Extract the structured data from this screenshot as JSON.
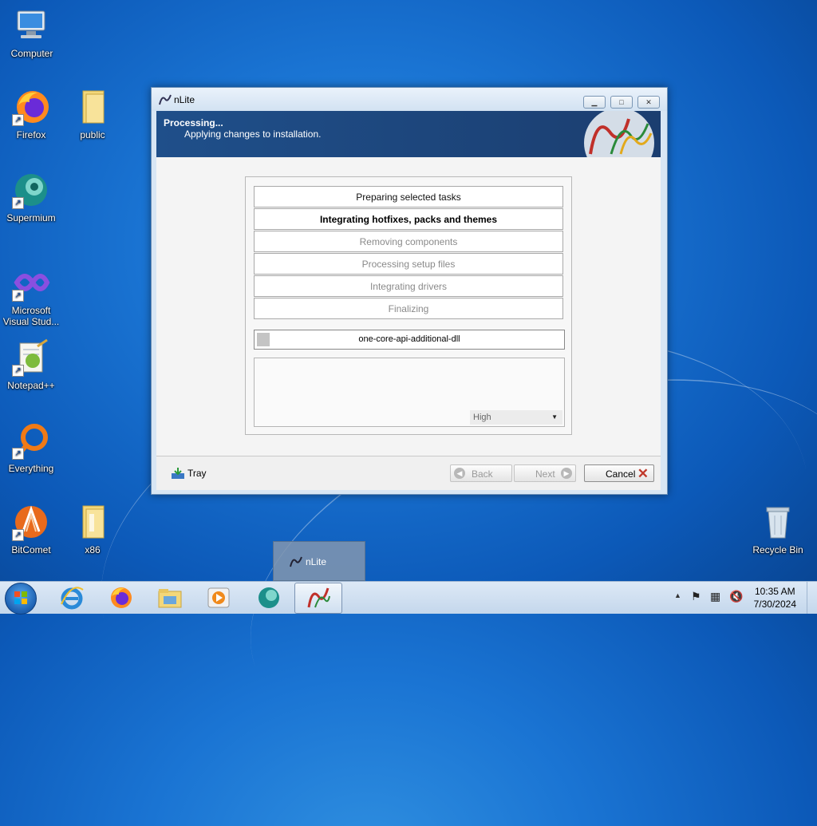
{
  "desktop": {
    "icons": [
      {
        "label": "Computer",
        "icon": "computer-icon"
      },
      {
        "label": "Firefox",
        "icon": "firefox-icon"
      },
      {
        "label": "public",
        "icon": "folder-icon"
      },
      {
        "label": "Supermium",
        "icon": "supermium-icon"
      },
      {
        "label": "Microsoft Visual Stud...",
        "icon": "visual-studio-icon"
      },
      {
        "label": "Notepad++",
        "icon": "notepadpp-icon"
      },
      {
        "label": "Everything",
        "icon": "everything-icon"
      },
      {
        "label": "BitComet",
        "icon": "bitcomet-icon"
      },
      {
        "label": "x86",
        "icon": "folder-icon"
      },
      {
        "label": "Recycle Bin",
        "icon": "recycle-bin-icon"
      }
    ]
  },
  "window": {
    "title": "nLite",
    "header_title": "Processing...",
    "header_subtitle": "Applying changes to installation.",
    "tasks": [
      {
        "label": "Preparing selected tasks",
        "state": "done"
      },
      {
        "label": "Integrating hotfixes, packs and themes",
        "state": "active"
      },
      {
        "label": "Removing components",
        "state": "pending"
      },
      {
        "label": "Processing setup files",
        "state": "pending"
      },
      {
        "label": "Integrating drivers",
        "state": "pending"
      },
      {
        "label": "Finalizing",
        "state": "pending"
      }
    ],
    "current_item": "one-core-api-additional-dll",
    "priority": "High",
    "buttons": {
      "tray": "Tray",
      "back": "Back",
      "next": "Next",
      "cancel": "Cancel"
    }
  },
  "taskbar": {
    "preview_label": "nLite",
    "time": "10:35 AM",
    "date": "7/30/2024"
  },
  "colors": {
    "header_bg": "#1f4f8a",
    "desktop_bg": "#1a74d3",
    "cancel_x": "#c0392b"
  }
}
